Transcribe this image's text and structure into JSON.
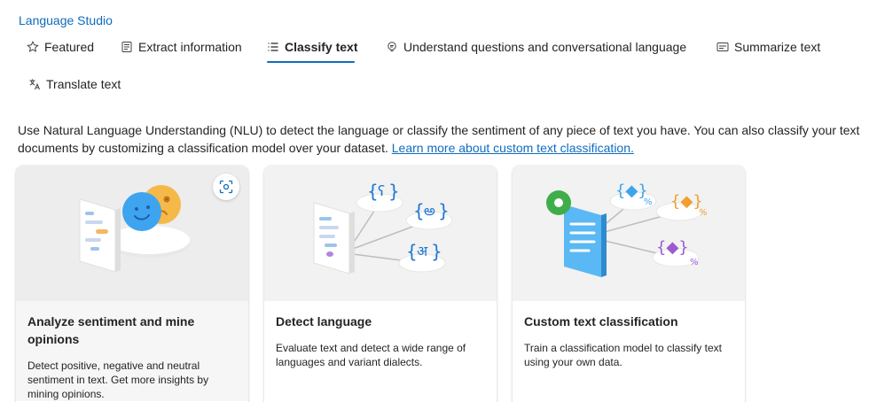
{
  "header": {
    "studio_link": "Language Studio"
  },
  "tabs": [
    {
      "label": "Featured",
      "icon": "star-icon",
      "active": false
    },
    {
      "label": "Extract information",
      "icon": "document-icon",
      "active": false
    },
    {
      "label": "Classify text",
      "icon": "list-icon",
      "active": true
    },
    {
      "label": "Understand questions and conversational language",
      "icon": "chat-bulb-icon",
      "active": false
    },
    {
      "label": "Summarize text",
      "icon": "summary-icon",
      "active": false
    },
    {
      "label": "Translate text",
      "icon": "translate-icon",
      "active": false
    }
  ],
  "intro": {
    "text": "Use Natural Language Understanding (NLU) to detect the language or classify the sentiment of any piece of text you have. You can also classify your text documents by customizing a classification model over your dataset. ",
    "link": "Learn more about custom text classification."
  },
  "cards": [
    {
      "title": "Analyze sentiment and mine opinions",
      "description": "Detect positive, negative and neutral sentiment in text. Get more insights by mining opinions."
    },
    {
      "title": "Detect language",
      "description": "Evaluate text and detect a wide range of languages and variant dialects."
    },
    {
      "title": "Custom text classification",
      "description": "Train a classification model to classify text using your own data."
    }
  ],
  "colors": {
    "accent": "#0f6cbd",
    "text": "#242424",
    "card_art_bg": "#f2f2f2"
  }
}
